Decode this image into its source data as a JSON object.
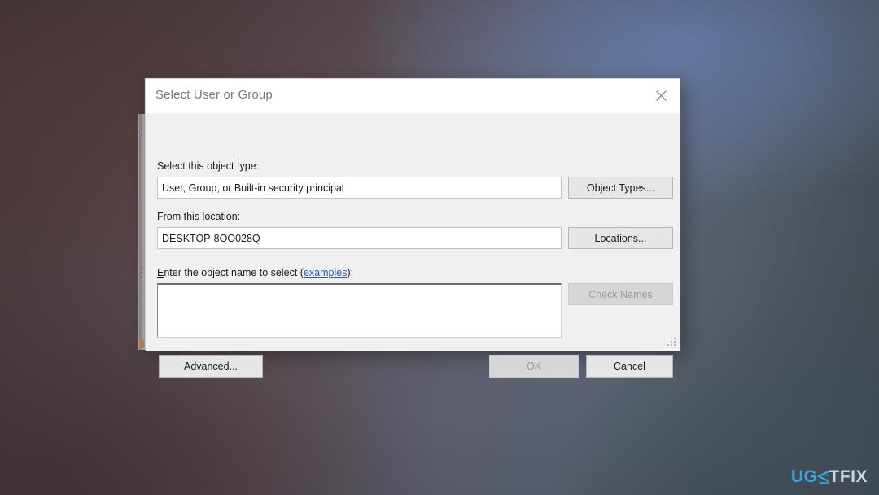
{
  "desktop": {
    "watermark": {
      "part1": "UG",
      "glyph": "less-than-or-equal-stylized-e",
      "part2": "TFIX",
      "color_primary": "#3da4d9",
      "color_secondary": "#cfd6da"
    },
    "background_colors": {
      "top_left": "#4b3a3c",
      "top_right": "#6c82b0",
      "bottom_left": "#4a363a",
      "bottom_right": "#4a5864"
    }
  },
  "dialog": {
    "title": "Select User or Group",
    "close_icon": "close-icon",
    "fields": {
      "object_type": {
        "label": "Select this object type:",
        "value": "User, Group, or Built-in security principal",
        "button": "Object Types..."
      },
      "location": {
        "label": "From this location:",
        "value": "DESKTOP-8OO028Q",
        "button": "Locations..."
      },
      "object_name": {
        "label_prefix": "E",
        "label_rest": "nter the object name to select (",
        "label_link": "examples",
        "label_suffix": "):",
        "value": "",
        "placeholder": "",
        "button": "Check Names",
        "button_disabled": true
      }
    },
    "buttons": {
      "advanced": "Advanced...",
      "ok": "OK",
      "ok_disabled": true,
      "cancel": "Cancel"
    },
    "resize_grip": "resize-grip"
  }
}
